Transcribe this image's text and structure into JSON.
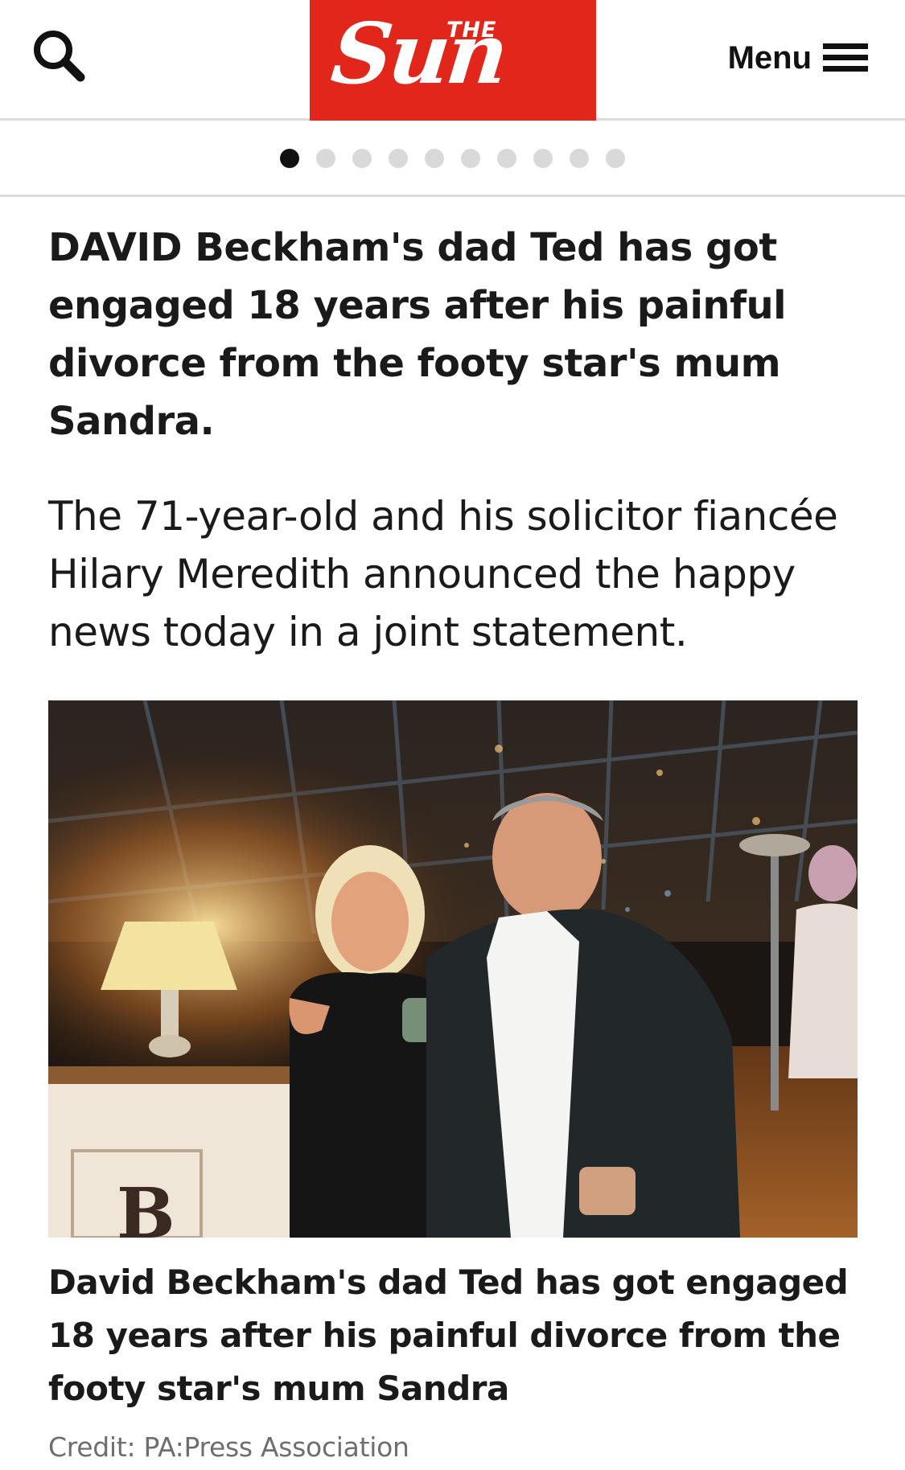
{
  "header": {
    "search_icon": "search-icon",
    "logo": {
      "the": "THE",
      "word": "Sun",
      "color": "#e1261c"
    },
    "menu_label": "Menu",
    "menu_icon": "hamburger-icon"
  },
  "pagination": {
    "total": 10,
    "active_index": 0
  },
  "article": {
    "headline": "DAVID Beckham's dad Ted has got engaged 18 years after his painful divorce from the footy star's mum Sandra.",
    "standfirst": "The 71-year-old and his solicitor fiancée Hilary Meredith announced the happy news today in a joint statement.",
    "photo": {
      "letter": "B"
    },
    "caption": "David Beckham's dad Ted has got engaged 18 years after his painful divorce from the footy star's mum Sandra",
    "credit": "Credit: PA:Press Association"
  }
}
